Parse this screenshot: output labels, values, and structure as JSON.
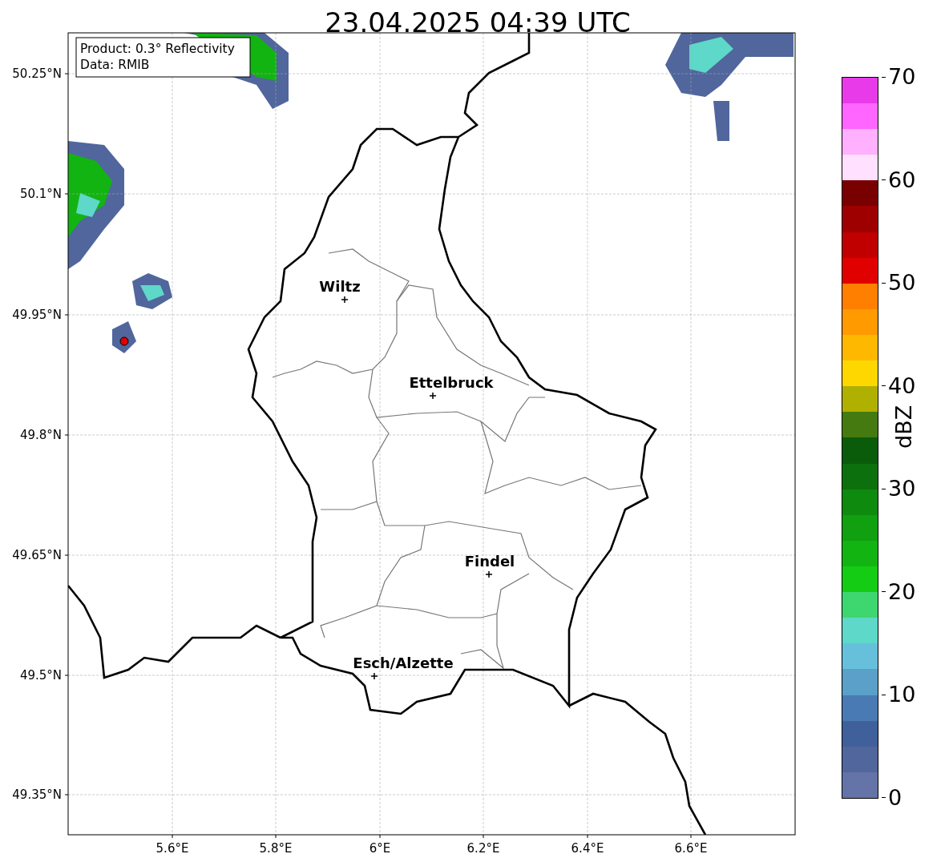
{
  "title": "23.04.2025 04:39 UTC",
  "annotation": [
    "Product: 0.3° Reflectivity",
    "Data: RMIB"
  ],
  "cities": [
    {
      "name": "Wiltz"
    },
    {
      "name": "Ettelbruck"
    },
    {
      "name": "Findel"
    },
    {
      "name": "Esch/Alzette"
    }
  ],
  "x_ticks": [
    "5.6°E",
    "5.8°E",
    "6°E",
    "6.2°E",
    "6.4°E",
    "6.6°E"
  ],
  "y_ticks": [
    "50.25°N",
    "50.1°N",
    "49.95°N",
    "49.8°N",
    "49.65°N",
    "49.5°N",
    "49.35°N"
  ],
  "colorbar": {
    "label": "dBZ",
    "ticks": [
      "70",
      "60",
      "50",
      "40",
      "30",
      "20",
      "10",
      "0"
    ],
    "bins": [
      {
        "color": "#6474a8"
      },
      {
        "color": "#50669c"
      },
      {
        "color": "#40609c"
      },
      {
        "color": "#4a7ab4"
      },
      {
        "color": "#5aa0c8"
      },
      {
        "color": "#66c0dc"
      },
      {
        "color": "#5ed8c8"
      },
      {
        "color": "#3ed66e"
      },
      {
        "color": "#14cc14"
      },
      {
        "color": "#12b412"
      },
      {
        "color": "#10a010"
      },
      {
        "color": "#0e8a0e"
      },
      {
        "color": "#0c700c"
      },
      {
        "color": "#0a5c0a"
      },
      {
        "color": "#457a10"
      },
      {
        "color": "#b0b000"
      },
      {
        "color": "#ffd700"
      },
      {
        "color": "#ffb800"
      },
      {
        "color": "#ff9a00"
      },
      {
        "color": "#ff7f00"
      },
      {
        "color": "#e00000"
      },
      {
        "color": "#c00000"
      },
      {
        "color": "#9e0000"
      },
      {
        "color": "#780000"
      },
      {
        "color": "#ffe0ff"
      },
      {
        "color": "#ffb0ff"
      },
      {
        "color": "#ff66ff"
      },
      {
        "color": "#e83ae8"
      }
    ]
  }
}
